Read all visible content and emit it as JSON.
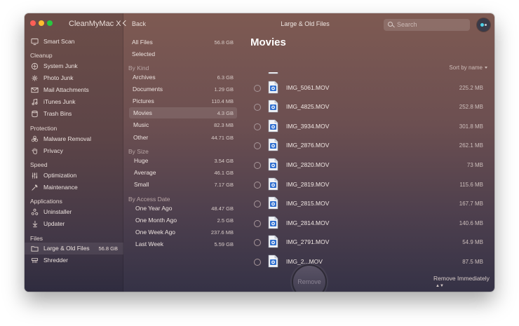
{
  "app_title": "CleanMyMac X",
  "window_title": "Large & Old Files",
  "back_label": "Back",
  "search": {
    "placeholder": "Search"
  },
  "sidebar": {
    "smart_scan": "Smart Scan",
    "sections": [
      {
        "title": "Cleanup",
        "items": [
          {
            "label": "System Junk",
            "icon": "system-junk-icon"
          },
          {
            "label": "Photo Junk",
            "icon": "photo-junk-icon"
          },
          {
            "label": "Mail Attachments",
            "icon": "mail-icon"
          },
          {
            "label": "iTunes Junk",
            "icon": "music-note-icon"
          },
          {
            "label": "Trash Bins",
            "icon": "trash-icon"
          }
        ]
      },
      {
        "title": "Protection",
        "items": [
          {
            "label": "Malware Removal",
            "icon": "biohazard-icon"
          },
          {
            "label": "Privacy",
            "icon": "hand-icon"
          }
        ]
      },
      {
        "title": "Speed",
        "items": [
          {
            "label": "Optimization",
            "icon": "sliders-icon"
          },
          {
            "label": "Maintenance",
            "icon": "wrench-icon"
          }
        ]
      },
      {
        "title": "Applications",
        "items": [
          {
            "label": "Uninstaller",
            "icon": "uninstaller-icon"
          },
          {
            "label": "Updater",
            "icon": "updater-icon"
          }
        ]
      },
      {
        "title": "Files",
        "items": [
          {
            "label": "Large & Old Files",
            "icon": "folder-icon",
            "count": "56.8 GB"
          },
          {
            "label": "Shredder",
            "icon": "shredder-icon"
          }
        ]
      }
    ]
  },
  "filters": {
    "all_files": {
      "label": "All Files",
      "size": "56.8 GB"
    },
    "selected": {
      "label": "Selected"
    },
    "by_kind": {
      "title": "By Kind",
      "items": [
        {
          "label": "Archives",
          "size": "6.3 GB"
        },
        {
          "label": "Documents",
          "size": "1.29 GB"
        },
        {
          "label": "Pictures",
          "size": "110.4 MB"
        },
        {
          "label": "Movies",
          "size": "4.3 GB"
        },
        {
          "label": "Music",
          "size": "82.3 MB"
        },
        {
          "label": "Other",
          "size": "44.71 GB"
        }
      ]
    },
    "by_size": {
      "title": "By Size",
      "items": [
        {
          "label": "Huge",
          "size": "3.54 GB"
        },
        {
          "label": "Average",
          "size": "46.1 GB"
        },
        {
          "label": "Small",
          "size": "7.17 GB"
        }
      ]
    },
    "by_date": {
      "title": "By Access Date",
      "items": [
        {
          "label": "One Year Ago",
          "size": "48.47 GB"
        },
        {
          "label": "One Month Ago",
          "size": "2.5 GB"
        },
        {
          "label": "One Week Ago",
          "size": "237.6 MB"
        },
        {
          "label": "Last Week",
          "size": "5.59 GB"
        }
      ]
    }
  },
  "main": {
    "title": "Movies",
    "sort_label": "Sort by name",
    "files": [
      {
        "name": "",
        "size": ""
      },
      {
        "name": "IMG_5061.MOV",
        "size": "225.2 MB"
      },
      {
        "name": "IMG_4825.MOV",
        "size": "252.8 MB"
      },
      {
        "name": "IMG_3934.MOV",
        "size": "301.8 MB"
      },
      {
        "name": "IMG_2876.MOV",
        "size": "262.1 MB"
      },
      {
        "name": "IMG_2820.MOV",
        "size": "73 MB"
      },
      {
        "name": "IMG_2819.MOV",
        "size": "115.6 MB"
      },
      {
        "name": "IMG_2815.MOV",
        "size": "167.7 MB"
      },
      {
        "name": "IMG_2814.MOV",
        "size": "140.6 MB"
      },
      {
        "name": "IMG_2791.MOV",
        "size": "54.9 MB"
      },
      {
        "name": "IMG_2...MOV",
        "size": "87.5 MB"
      }
    ],
    "remove_mode": "Remove Immediately",
    "remove_button": "Remove"
  }
}
